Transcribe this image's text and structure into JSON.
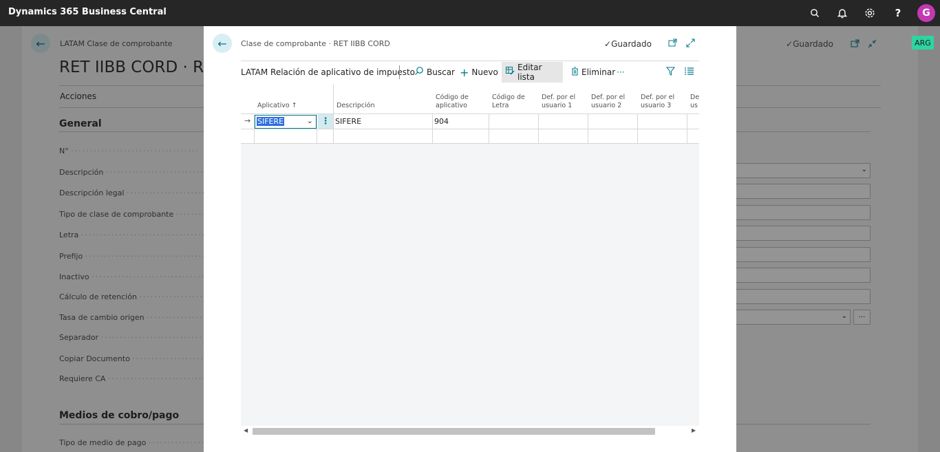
{
  "topbar": {
    "app_title": "Dynamics 365 Business Central",
    "avatar_initial": "G",
    "help_label": "?"
  },
  "background_page": {
    "breadcrumb": "LATAM Clase de comprobante",
    "title": "RET IIBB CORD · Rete",
    "actions_label": "Acciones",
    "saved_label": "Guardado",
    "company_badge": "ARG",
    "general_section": "General",
    "fields": [
      "N°",
      "Descripción",
      "Descripción legal",
      "Tipo de clase de comprobante",
      "Letra",
      "Prefijo",
      "Inactivo",
      "Cálculo de retención",
      "Tasa de cambio origen",
      "Separador",
      "Copiar Documento",
      "Requiere CA"
    ],
    "payments_section": "Medios de cobro/pago",
    "payments_fields": [
      "Tipo de medio de pago"
    ],
    "more_label": "···"
  },
  "dialog": {
    "breadcrumb": "Clase de comprobante · RET IIBB CORD",
    "saved_label": "Guardado",
    "list_title": "LATAM Relación de aplicativo de impuesto",
    "toolbar": {
      "search_label": "Buscar",
      "new_label": "Nuevo",
      "edit_list_label": "Editar lista",
      "delete_label": "Eliminar",
      "more_label": "···"
    },
    "columns": {
      "aplicativo": "Aplicativo",
      "sort_indicator": "↑",
      "descripcion": "Descripción",
      "codigo_aplicativo_1": "Código de",
      "codigo_aplicativo_2": "aplicativo",
      "codigo_letra_1": "Código de",
      "codigo_letra_2": "Letra",
      "def1_1": "Def. por el",
      "def1_2": "usuario 1",
      "def2_1": "Def. por el",
      "def2_2": "usuario 2",
      "def3_1": "Def. por el",
      "def3_2": "usuario 3",
      "def4_1": "De",
      "def4_2": "us"
    },
    "rows": [
      {
        "aplicativo": "SIFERE",
        "descripcion": "SIFERE",
        "codigo_aplicativo": "904"
      }
    ]
  }
}
